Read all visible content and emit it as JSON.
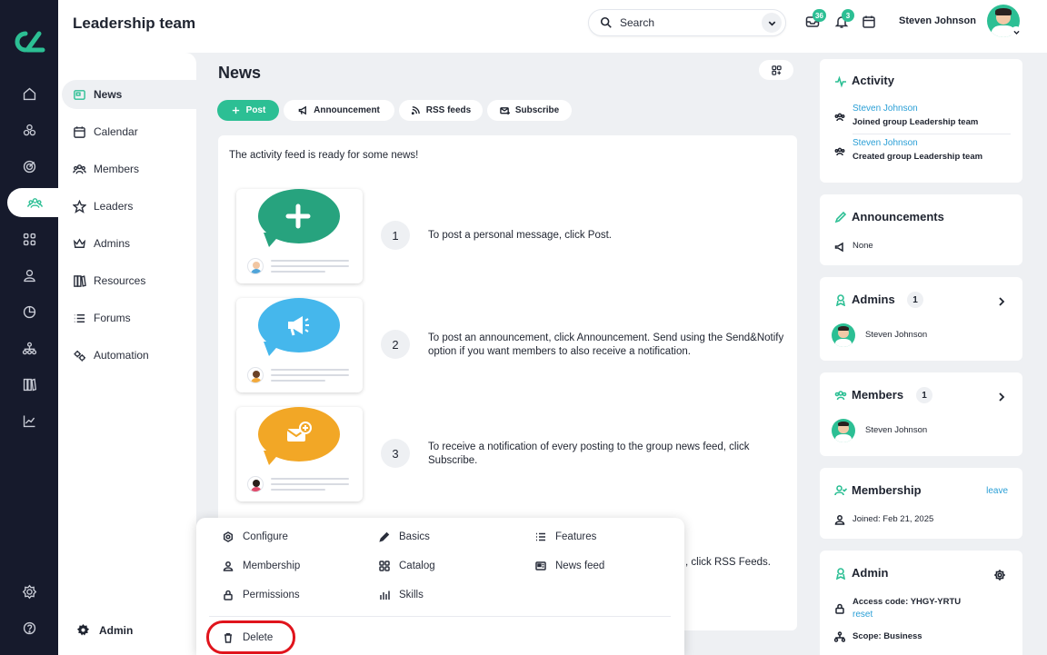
{
  "app": {
    "group_title": "Leadership team",
    "accent": "#2cbf94",
    "link_color": "#2a9fd6"
  },
  "rail": [
    "home-icon",
    "apps-icon",
    "target-icon",
    "groups-icon",
    "grid-icon",
    "person-icon",
    "chart-pie-icon",
    "org-chart-icon",
    "library-icon",
    "trend-icon",
    "settings-icon",
    "help-icon"
  ],
  "subnav": {
    "items": [
      {
        "label": "News",
        "icon": "news-icon",
        "active": true
      },
      {
        "label": "Calendar",
        "icon": "calendar-icon"
      },
      {
        "label": "Members",
        "icon": "members-icon"
      },
      {
        "label": "Leaders",
        "icon": "star-icon"
      },
      {
        "label": "Admins",
        "icon": "crown-icon"
      },
      {
        "label": "Resources",
        "icon": "books-icon"
      },
      {
        "label": "Forums",
        "icon": "list-icon"
      },
      {
        "label": "Automation",
        "icon": "gears-icon"
      }
    ],
    "bottom_label": "Admin"
  },
  "topbar": {
    "search_placeholder": "Search",
    "messages_badge": "36",
    "notifications_badge": "3",
    "user_name": "Steven Johnson"
  },
  "main": {
    "title": "News",
    "actions": {
      "post": "Post",
      "announcement": "Announcement",
      "rss": "RSS feeds",
      "subscribe": "Subscribe"
    },
    "intro": "The activity feed is ready for some news!",
    "steps": [
      {
        "num": "1",
        "text": "To post a personal message, click Post."
      },
      {
        "num": "2",
        "text": "To post an announcement, click Announcement. Send using the Send&Notify option if you want members to also receive a notification."
      },
      {
        "num": "3",
        "text": "To receive a notification of every posting to the group news feed, click Subscribe."
      }
    ],
    "step4_tail": ", click RSS Feeds."
  },
  "popup": {
    "configure": "Configure",
    "basics": "Basics",
    "features": "Features",
    "membership": "Membership",
    "catalog": "Catalog",
    "news_feed": "News feed",
    "permissions": "Permissions",
    "skills": "Skills",
    "delete": "Delete"
  },
  "right": {
    "activity": {
      "title": "Activity",
      "entries": [
        {
          "user": "Steven Johnson",
          "action": "Joined group Leadership team"
        },
        {
          "user": "Steven Johnson",
          "action": "Created group Leadership team"
        }
      ]
    },
    "announcements": {
      "title": "Announcements",
      "value": "None"
    },
    "admins": {
      "title": "Admins",
      "count": "1",
      "person": "Steven Johnson"
    },
    "members": {
      "title": "Members",
      "count": "1",
      "person": "Steven Johnson"
    },
    "membership": {
      "title": "Membership",
      "leave": "leave",
      "joined": "Joined: Feb 21, 2025"
    },
    "admin": {
      "title": "Admin",
      "access_code": "Access code: YHGY-YRTU",
      "reset": "reset",
      "scope": "Scope: Business"
    }
  }
}
